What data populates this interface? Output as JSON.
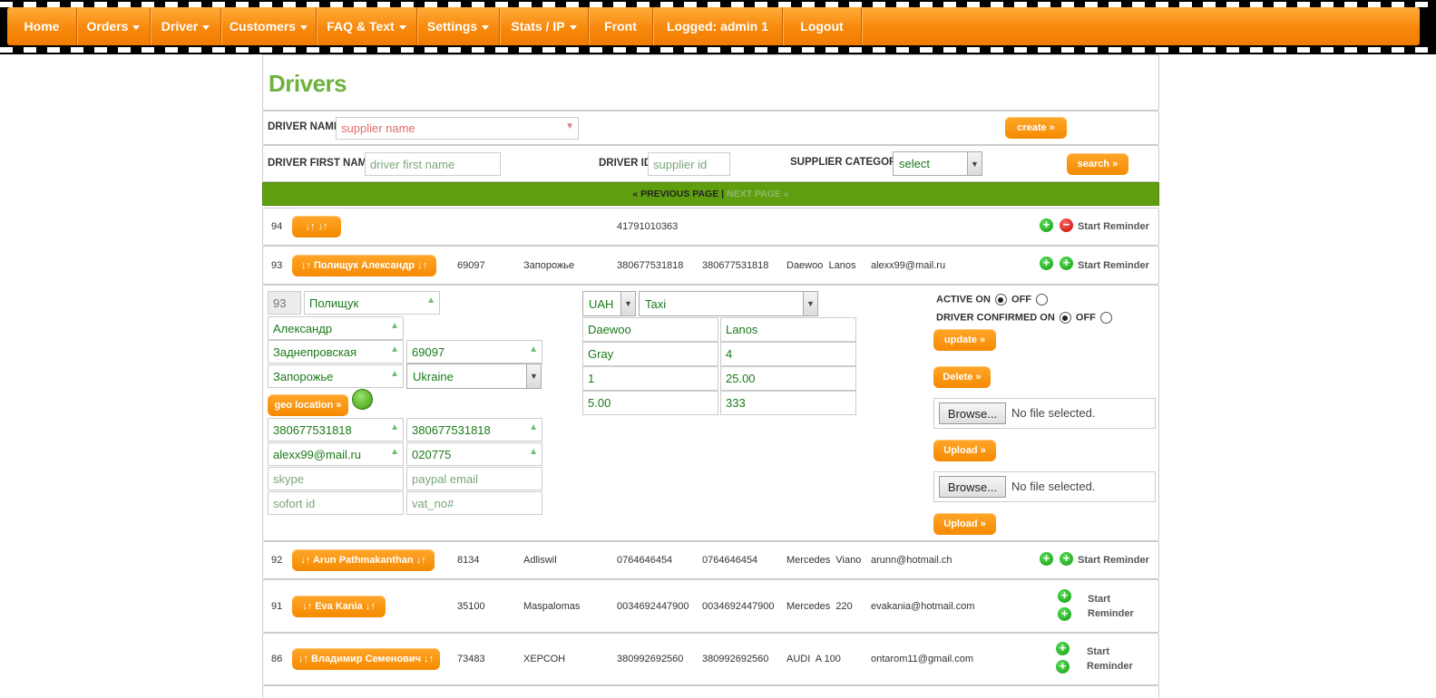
{
  "nav": {
    "items": [
      {
        "label": "Home",
        "caret": false
      },
      {
        "label": "Orders",
        "caret": true
      },
      {
        "label": "Driver",
        "caret": true
      },
      {
        "label": "Customers",
        "caret": true
      },
      {
        "label": "FAQ & Text",
        "caret": true
      },
      {
        "label": "Settings",
        "caret": true
      },
      {
        "label": "Stats / IP",
        "caret": true
      },
      {
        "label": "Front",
        "caret": false
      },
      {
        "label": "Logged: admin 1",
        "caret": false
      },
      {
        "label": "Logout",
        "caret": false
      }
    ]
  },
  "page_title": "Drivers",
  "search_form": {
    "driver_name_label": "DRIVER NAME",
    "driver_name_placeholder": "supplier name",
    "create_label": "create »",
    "first_name_label": "DRIVER FIRST NAME",
    "first_name_placeholder": "driver first name",
    "driver_id_label": "DRIVER ID",
    "driver_id_placeholder": "supplier id",
    "category_label": "SUPPLIER CATEGORY",
    "category_value": "select",
    "search_label": "search »"
  },
  "pager": {
    "prev": "« PREVIOUS PAGE",
    "sep": "|",
    "next": "NEXT PAGE »"
  },
  "rows": [
    {
      "id": "94",
      "name_button": "↓↑ ↓↑",
      "zip": "",
      "city": "",
      "phone1": "41791010363",
      "phone2": "",
      "car": "",
      "email": "",
      "reminder": "Start Reminder"
    },
    {
      "id": "93",
      "name_button": "↓↑ Полищук Александр ↓↑",
      "zip": "69097",
      "city": "Запорожье",
      "phone1": "380677531818",
      "phone2": "380677531818",
      "car": "Daewoo  Lanos",
      "email": "alexx99@mail.ru",
      "reminder": "Start Reminder"
    },
    {
      "id": "92",
      "name_button": "↓↑ Arun Pathmakanthan ↓↑",
      "zip": "8134",
      "city": "Adliswil",
      "phone1": "0764646454",
      "phone2": "0764646454",
      "car": "Mercedes  Viano",
      "email": "arunn@hotmail.ch",
      "reminder": "Start Reminder"
    },
    {
      "id": "91",
      "name_button": "↓↑ Eva  Kania ↓↑",
      "zip": "35100",
      "city": "Maspalomas",
      "phone1": "0034692447900",
      "phone2": "0034692447900",
      "car": "Mercedes  220",
      "email": "evakania@hotmail.com",
      "reminder_line1": "Start",
      "reminder_line2": "Reminder"
    },
    {
      "id": "86",
      "name_button": "↓↑ Владимир Семенович ↓↑",
      "zip": "73483",
      "city": "ХЕРСОН",
      "phone1": "380992692560",
      "phone2": "380992692560",
      "car": "AUDI  A 100",
      "email": "ontarom11@gmail.com",
      "reminder_line1": "Start",
      "reminder_line2": "Reminder"
    }
  ],
  "edit": {
    "id": "93",
    "last_name": "Полищук",
    "first_name": "Александр",
    "street": "Заднепровская",
    "zip": "69097",
    "city": "Запорожье",
    "country": "Ukraine",
    "geo_label": "geo location »",
    "phone1": "380677531818",
    "phone2": "380677531818",
    "email": "alexx99@mail.ru",
    "code": "020775",
    "skype_placeholder": "skype",
    "paypal_placeholder": "paypal email",
    "sofort_placeholder": "sofort id",
    "vat_placeholder": "vat_no#",
    "currency": "UAH",
    "category": "Taxi",
    "make": "Daewoo",
    "model": "Lanos",
    "color": "Gray",
    "seats": "4",
    "f1": "1",
    "f2": "25.00",
    "f3": "5.00",
    "f4": "333",
    "active_label": "ACTIVE ON",
    "off_label": "OFF",
    "confirmed_label": "DRIVER CONFIRMED ON",
    "update_label": "update »",
    "delete_label": "Delete »",
    "browse_label": "Browse...",
    "no_file": "No file selected.",
    "upload_label": "Upload »"
  }
}
